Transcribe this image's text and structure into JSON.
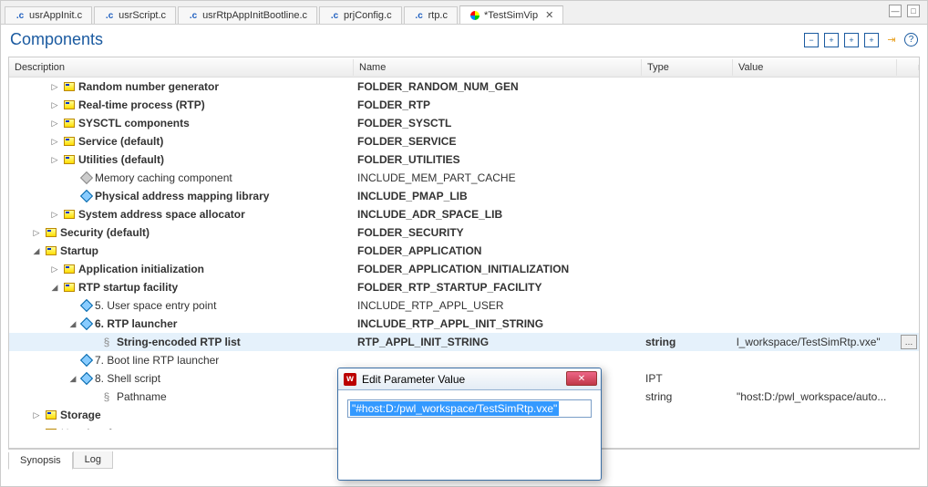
{
  "tabs": [
    {
      "label": "usrAppInit.c",
      "icon": "c"
    },
    {
      "label": "usrScript.c",
      "icon": "c"
    },
    {
      "label": "usrRtpAppInitBootline.c",
      "icon": "c"
    },
    {
      "label": "prjConfig.c",
      "icon": "c"
    },
    {
      "label": "rtp.c",
      "icon": "c"
    },
    {
      "label": "*TestSimVip",
      "icon": "tv",
      "active": true,
      "closable": true
    }
  ],
  "panel": {
    "title": "Components"
  },
  "columns": {
    "c0": "Description",
    "c1": "Name",
    "c2": "Type",
    "c3": "Value"
  },
  "rows": [
    {
      "depth": 1,
      "tw": "▷",
      "icon": "folder",
      "bold": true,
      "desc": "Random number generator",
      "name": "FOLDER_RANDOM_NUM_GEN"
    },
    {
      "depth": 1,
      "tw": "▷",
      "icon": "folder",
      "bold": true,
      "desc": "Real-time process (RTP)",
      "name": "FOLDER_RTP"
    },
    {
      "depth": 1,
      "tw": "▷",
      "icon": "folder",
      "bold": true,
      "desc": "SYSCTL components",
      "name": "FOLDER_SYSCTL"
    },
    {
      "depth": 1,
      "tw": "▷",
      "icon": "folder",
      "bold": true,
      "desc": "Service (default)",
      "name": "FOLDER_SERVICE"
    },
    {
      "depth": 1,
      "tw": "▷",
      "icon": "folder",
      "bold": true,
      "desc": "Utilities (default)",
      "name": "FOLDER_UTILITIES"
    },
    {
      "depth": 2,
      "tw": "",
      "icon": "comp-gray",
      "bold": false,
      "desc": "Memory caching component",
      "name": "INCLUDE_MEM_PART_CACHE"
    },
    {
      "depth": 2,
      "tw": "",
      "icon": "comp",
      "bold": true,
      "desc": "Physical address mapping library",
      "name": "INCLUDE_PMAP_LIB"
    },
    {
      "depth": 1,
      "tw": "▷",
      "icon": "folder",
      "bold": true,
      "desc": "System address space allocator",
      "name": "INCLUDE_ADR_SPACE_LIB"
    },
    {
      "depth": 0,
      "tw": "▷",
      "icon": "folder",
      "bold": true,
      "desc": "Security (default)",
      "name": "FOLDER_SECURITY"
    },
    {
      "depth": 0,
      "tw": "◢",
      "icon": "folder",
      "bold": true,
      "desc": "Startup",
      "name": "FOLDER_APPLICATION"
    },
    {
      "depth": 1,
      "tw": "▷",
      "icon": "folder",
      "bold": true,
      "desc": "Application initialization",
      "name": "FOLDER_APPLICATION_INITIALIZATION"
    },
    {
      "depth": 1,
      "tw": "◢",
      "icon": "folder",
      "bold": true,
      "desc": "RTP startup facility",
      "name": "FOLDER_RTP_STARTUP_FACILITY"
    },
    {
      "depth": 2,
      "tw": "",
      "icon": "comp",
      "bold": false,
      "desc": "5. User space entry point",
      "name": "INCLUDE_RTP_APPL_USER"
    },
    {
      "depth": 2,
      "tw": "◢",
      "icon": "comp",
      "bold": true,
      "desc": "6. RTP launcher",
      "name": "INCLUDE_RTP_APPL_INIT_STRING"
    },
    {
      "depth": 3,
      "tw": "",
      "icon": "param",
      "bold": true,
      "desc": "String-encoded RTP list",
      "name": "RTP_APPL_INIT_STRING",
      "type": "string",
      "value": "l_workspace/TestSimRtp.vxe\"",
      "valbtn": true,
      "selected": true
    },
    {
      "depth": 2,
      "tw": "",
      "icon": "comp",
      "bold": false,
      "desc": "7. Boot line RTP launcher",
      "name": ""
    },
    {
      "depth": 2,
      "tw": "◢",
      "icon": "comp",
      "bold": false,
      "desc": "8. Shell script",
      "name": "",
      "type_suffix": "IPT"
    },
    {
      "depth": 3,
      "tw": "",
      "icon": "param",
      "bold": false,
      "desc": "Pathname",
      "name": "",
      "type": "string",
      "value": "\"host:D:/pwl_workspace/auto..."
    },
    {
      "depth": 0,
      "tw": "▷",
      "icon": "folder",
      "bold": true,
      "desc": "Storage",
      "name": ""
    },
    {
      "depth": 0,
      "tw": "▷",
      "icon": "folder",
      "bold": false,
      "dim": true,
      "desc": "User interface components",
      "name": ""
    }
  ],
  "bottom_tabs": {
    "t0": "Synopsis",
    "t1": "Log"
  },
  "dialog": {
    "title": "Edit Parameter Value",
    "value": "\"#host:D:/pwl_workspace/TestSimRtp.vxe\""
  }
}
